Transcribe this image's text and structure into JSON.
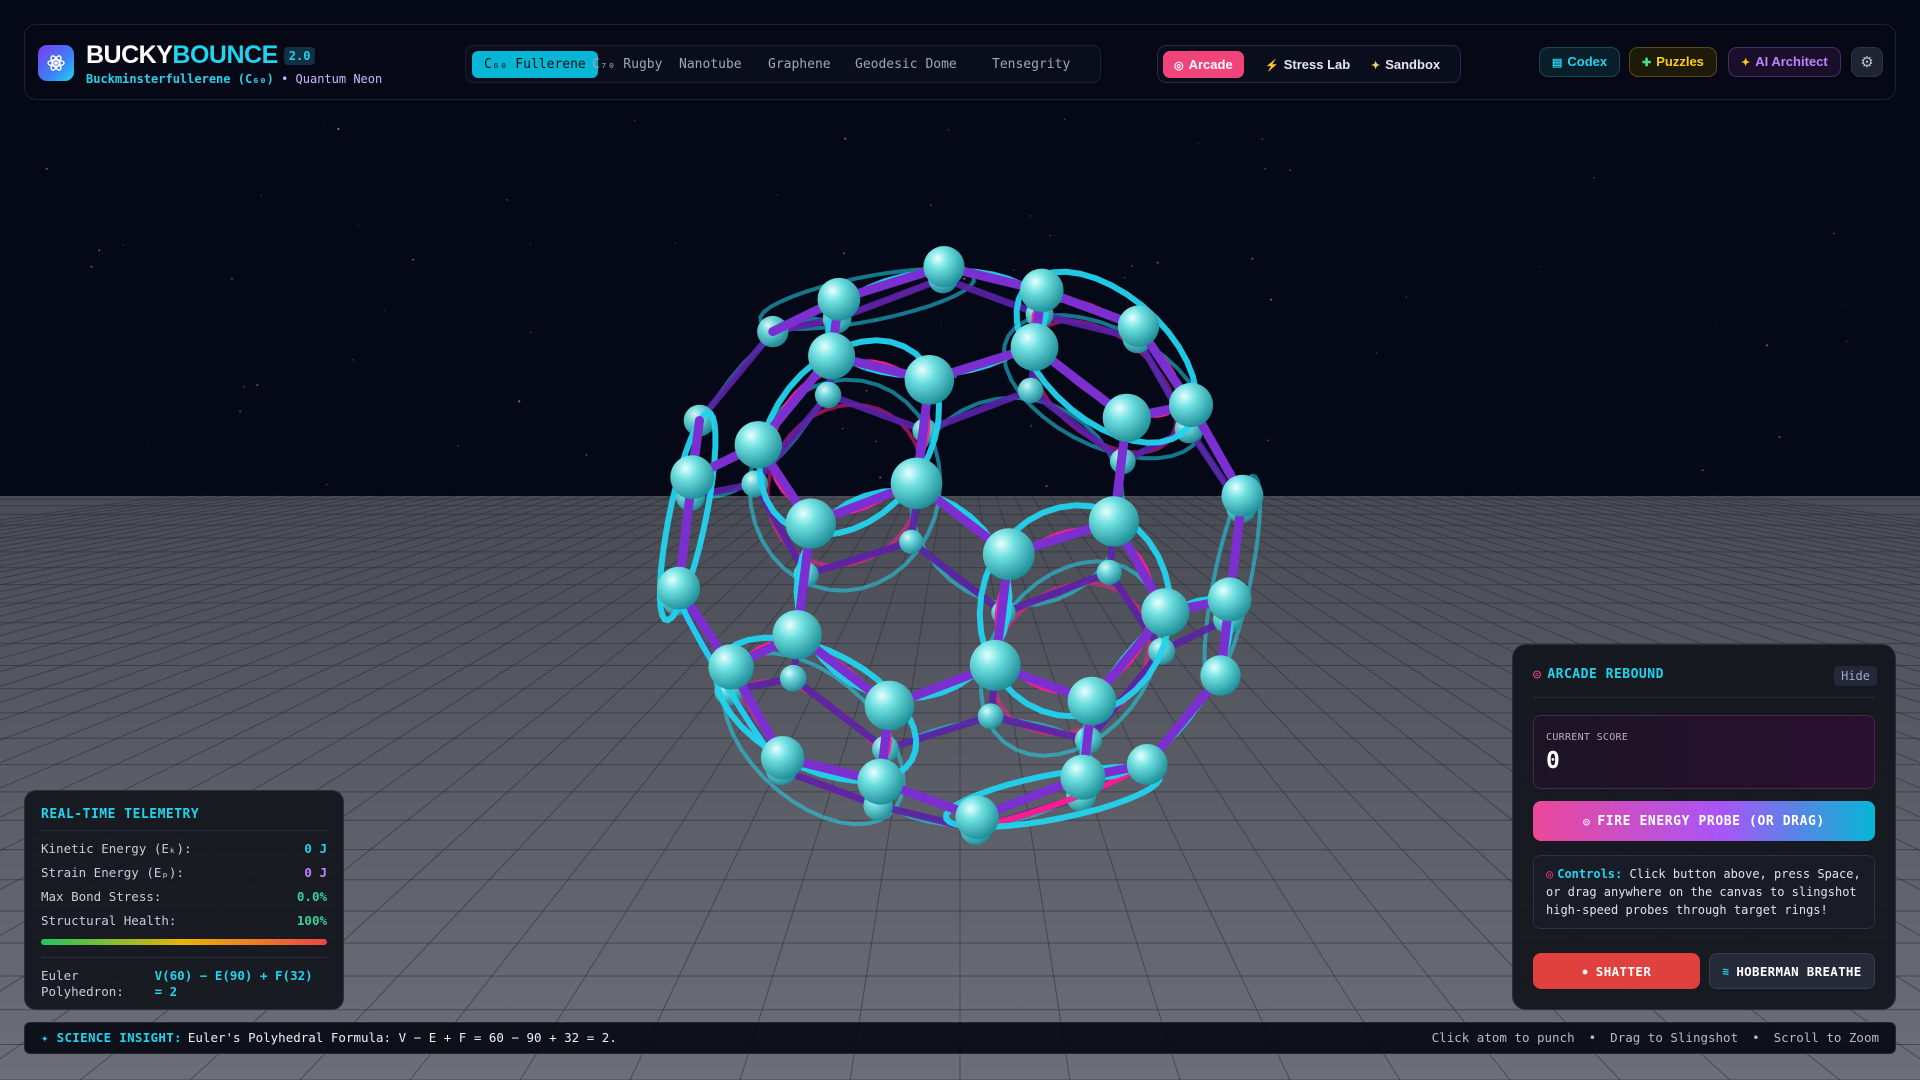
{
  "app": {
    "title_part1": "BUCKY",
    "title_part2": "BOUNCE",
    "version": "2.0",
    "subtitle_molecule": "Buckminsterfullerene (C₆₀)",
    "subtitle_theme": "• Quantum Neon",
    "logo_icon": "atom-icon"
  },
  "structure_tabs": [
    {
      "label": "C₆₀ Fullerene",
      "active": true
    },
    {
      "label": "C₇₀ Rugby",
      "active": false
    },
    {
      "label": "Nanotube",
      "active": false
    },
    {
      "label": "Graphene",
      "active": false
    },
    {
      "label": "Geodesic Dome",
      "active": false
    },
    {
      "label": "Tensegrity",
      "active": false
    }
  ],
  "modes": [
    {
      "label": "Arcade",
      "icon": "target-icon",
      "active": true
    },
    {
      "label": "Stress Lab",
      "icon": "bolt-icon",
      "active": false
    },
    {
      "label": "Sandbox",
      "icon": "sparkle-icon",
      "active": false
    }
  ],
  "tools": {
    "codex": {
      "label": "Codex",
      "icon": "book-icon"
    },
    "puzzles": {
      "label": "Puzzles",
      "icon": "puzzle-icon"
    },
    "ai_architect": {
      "label": "AI Architect",
      "icon": "sparkle-icon"
    },
    "settings_icon": "gear-icon"
  },
  "telemetry": {
    "title": "REAL-TIME TELEMETRY",
    "rows": [
      {
        "label": "Kinetic Energy (Eₖ):",
        "value": "0 J",
        "color": "#22d3ee"
      },
      {
        "label": "Strain Energy (Eₚ):",
        "value": "0 J",
        "color": "#c084fc"
      },
      {
        "label": "Max Bond Stress:",
        "value": "0.0%",
        "color": "#34d399"
      },
      {
        "label": "Structural Health:",
        "value": "100%",
        "color": "#34d399"
      }
    ],
    "health_fraction": 1.0,
    "euler_label": "Euler Polyhedron:",
    "euler_value": "V(60) − E(90) + F(32) = 2"
  },
  "arcade": {
    "title": "ARCADE REBOUND",
    "hide_label": "Hide",
    "score_label": "CURRENT SCORE",
    "score_value": "0",
    "fire_label": "FIRE ENERGY PROBE (OR DRAG)",
    "controls_key": "Controls:",
    "controls_text": "Click button above, press Space, or drag anywhere on the canvas to slingshot high-speed probes through target rings!",
    "shatter_label": "SHATTER",
    "hoberman_label": "HOBERMAN BREATHE"
  },
  "footer": {
    "insight_key": "✦ SCIENCE INSIGHT:",
    "insight_text": "Euler's Polyhedral Formula: V − E + F = 60 − 90 + 32 = 2.",
    "hint_1": "Click atom to punch",
    "hint_2": "Drag to Slingshot",
    "hint_3": "Scroll to Zoom"
  },
  "colors": {
    "accent_cyan": "#22d3ee",
    "accent_pink": "#f0447a",
    "bond_purple": "#7b2fd0",
    "ring_pink": "#ff1d8e",
    "atom_cyan": "#4fd4d4"
  }
}
